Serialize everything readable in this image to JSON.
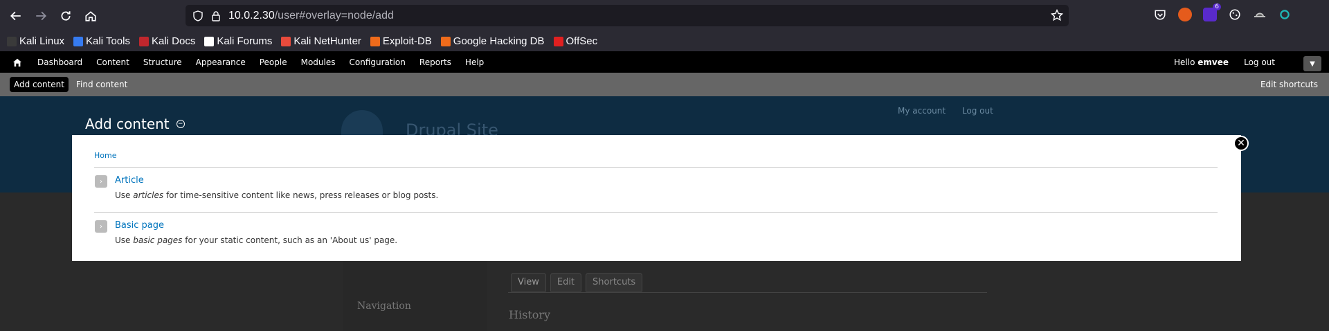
{
  "browser": {
    "url_host": "10.0.2.30",
    "url_path": "/user#overlay=node/add",
    "ext_badge": "6"
  },
  "bookmarks": [
    {
      "label": "Kali Linux",
      "icon": "kali-dragon-icon",
      "color": "#3a3a3a"
    },
    {
      "label": "Kali Tools",
      "icon": "kali-tools-icon",
      "color": "#367bf0"
    },
    {
      "label": "Kali Docs",
      "icon": "kali-docs-icon",
      "color": "#c0272d"
    },
    {
      "label": "Kali Forums",
      "icon": "kali-forums-icon",
      "color": "#ffffff"
    },
    {
      "label": "Kali NetHunter",
      "icon": "nethunter-icon",
      "color": "#e94b3c"
    },
    {
      "label": "Exploit-DB",
      "icon": "exploitdb-icon",
      "color": "#ef6b1b"
    },
    {
      "label": "Google Hacking DB",
      "icon": "ghdb-icon",
      "color": "#ef6b1b"
    },
    {
      "label": "OffSec",
      "icon": "offsec-icon",
      "color": "#e02020"
    }
  ],
  "toolbar": {
    "menu": [
      "Dashboard",
      "Content",
      "Structure",
      "Appearance",
      "People",
      "Modules",
      "Configuration",
      "Reports",
      "Help"
    ],
    "hello": "Hello ",
    "user": "emvee",
    "logout": "Log out"
  },
  "shortcuts": {
    "add_content": "Add content",
    "find_content": "Find content",
    "edit_shortcuts": "Edit shortcuts"
  },
  "background": {
    "my_account": "My account",
    "log_out": "Log out",
    "site_name": "Drupal Site",
    "tabs": [
      "View",
      "Edit",
      "Shortcuts"
    ],
    "navigation": "Navigation",
    "history": "History"
  },
  "overlay": {
    "title": "Add content",
    "breadcrumb": "Home",
    "items": [
      {
        "title": "Article",
        "desc_pre": "Use ",
        "desc_em": "articles",
        "desc_post": " for time-sensitive content like news, press releases or blog posts."
      },
      {
        "title": "Basic page",
        "desc_pre": "Use ",
        "desc_em": "basic pages",
        "desc_post": " for your static content, such as an 'About us' page."
      }
    ]
  }
}
